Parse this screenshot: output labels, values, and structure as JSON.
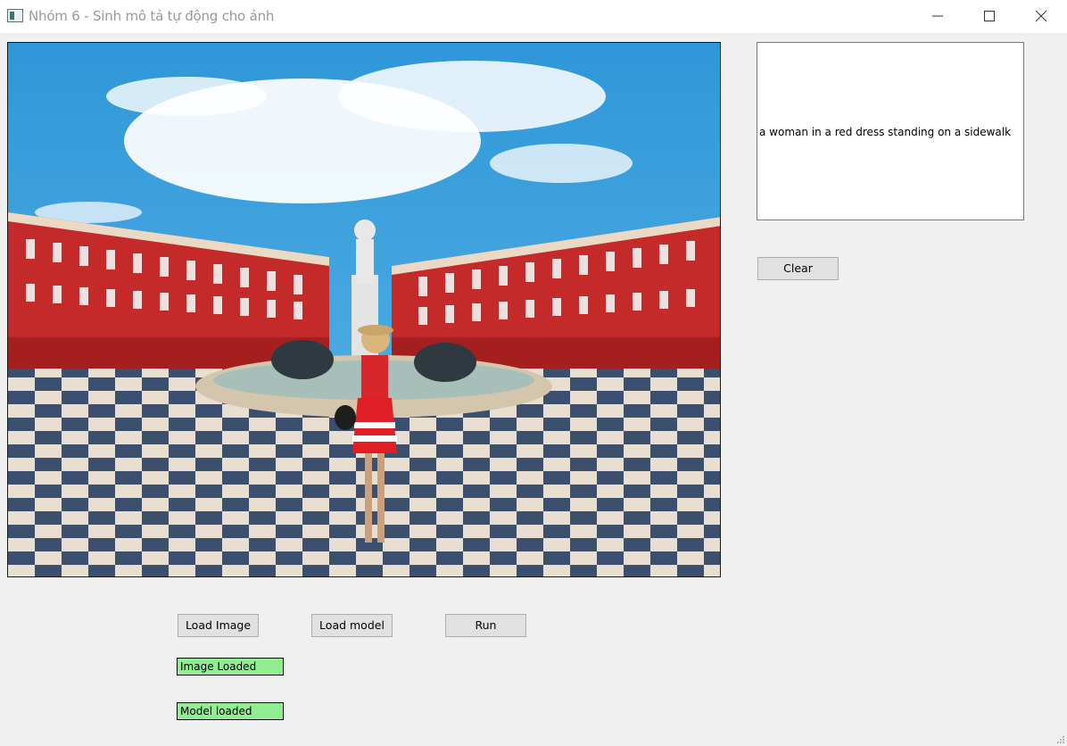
{
  "window": {
    "title": "Nhóm 6 - Sinh mô tả tự động cho ảnh",
    "icon": "app-window-icon",
    "controls": [
      "minimize-icon",
      "maximize-icon",
      "close-icon"
    ]
  },
  "caption": {
    "text": "a woman in a red dress standing on a sidewalk"
  },
  "buttons": {
    "clear": "Clear",
    "load_image": "Load Image",
    "load_model": "Load model",
    "run": "Run"
  },
  "status": {
    "image": "Image Loaded",
    "model": "Model loaded",
    "color": "#90ee90"
  }
}
